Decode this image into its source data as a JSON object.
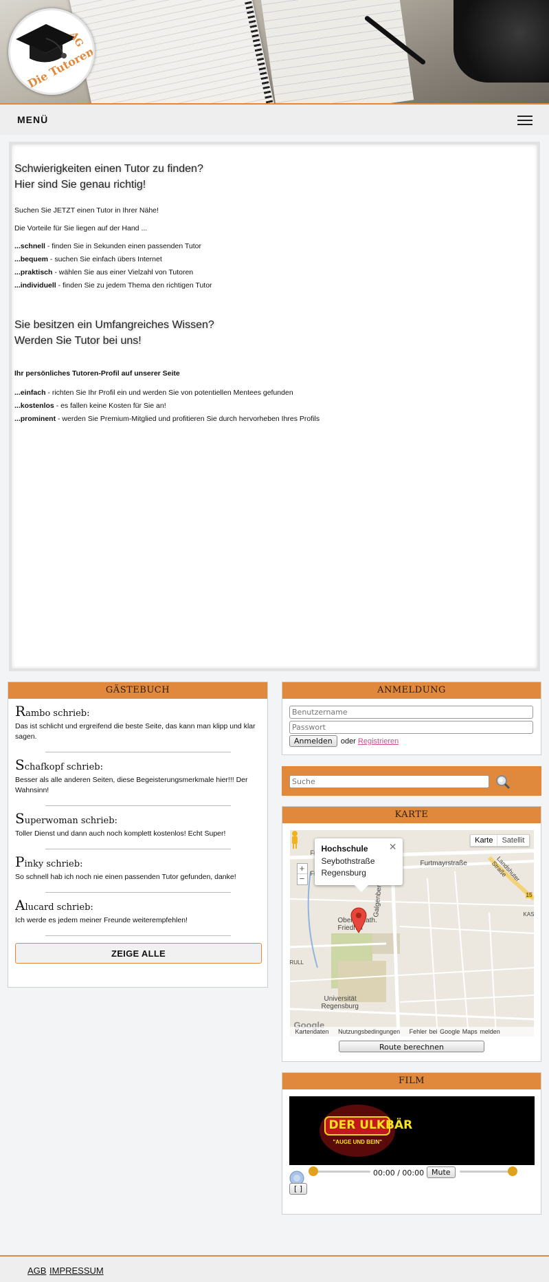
{
  "header": {
    "logo_text": "Die Tutoren AG"
  },
  "menu": {
    "label": "MENÜ",
    "toggle_icon": "hamburger-icon"
  },
  "main": {
    "heading1_line1": "Schwierigkeiten einen Tutor zu finden?",
    "heading1_line2": "Hier sind Sie genau richtig!",
    "intro1": "Suchen Sie JETZT einen Tutor in Ihrer Nähe!",
    "intro2": "Die Vorteile für Sie liegen auf der Hand ...",
    "advantages": [
      {
        "key": "...schnell",
        "text": " - finden Sie in Sekunden einen passenden Tutor"
      },
      {
        "key": "...bequem",
        "text": " - suchen Sie einfach übers Internet"
      },
      {
        "key": "...praktisch",
        "text": " - wählen Sie aus einer Vielzahl von Tutoren"
      },
      {
        "key": "...individuell",
        "text": " - finden Sie zu jedem Thema den richtigen Tutor"
      }
    ],
    "heading2_line1": "Sie besitzen ein Umfangreiches Wissen?",
    "heading2_line2": "Werden Sie Tutor bei uns!",
    "profile_title": "Ihr persönliches Tutoren-Profil auf unserer Seite",
    "profile_features": [
      {
        "key": "...einfach",
        "text": " - richten Sie Ihr Profil ein und werden Sie von potentiellen Mentees gefunden"
      },
      {
        "key": "...kostenlos",
        "text": " - es fallen keine Kosten für Sie an!"
      },
      {
        "key": "...prominent",
        "text": " - werden Sie Premium-Mitglied und profitieren Sie durch hervorheben Ihres Profils"
      }
    ]
  },
  "guestbook": {
    "title": "GÄSTEBUCH",
    "entries": [
      {
        "cap": "R",
        "name": "ambo schrieb:",
        "text": "Das ist schlicht und ergreifend die beste Seite, das kann man klipp und klar sagen."
      },
      {
        "cap": "S",
        "name": "chafkopf schrieb:",
        "text": "Besser als alle anderen Seiten, diese Begeisterungsmerkmale hier!!! Der Wahnsinn!"
      },
      {
        "cap": "S",
        "name": "uperwoman schrieb:",
        "text": "Toller Dienst und dann auch noch komplett kostenlos! Echt Super!"
      },
      {
        "cap": "P",
        "name": "inky schrieb:",
        "text": "So schnell hab ich noch nie einen passenden Tutor gefunden, danke!"
      },
      {
        "cap": "A",
        "name": "lucard schrieb:",
        "text": "Ich werde es jedem meiner Freunde weiterempfehlen!"
      }
    ],
    "show_all": "ZEIGE ALLE"
  },
  "login": {
    "title": "ANMELDUNG",
    "username_placeholder": "Benutzername",
    "password_placeholder": "Passwort",
    "login_button": "Anmelden",
    "or_text": "oder",
    "register_link": "Registrieren"
  },
  "search": {
    "placeholder": "Suche",
    "icon": "magnifier-icon"
  },
  "map": {
    "title": "KARTE",
    "popup_title": "Hochschule",
    "popup_street": "Seybothstraße",
    "popup_city": "Regensburg",
    "popup_close": "✕",
    "type_map": "Karte",
    "type_satellite": "Satellit",
    "zoom_in": "+",
    "zoom_out": "−",
    "labels": {
      "furtmayr": "Furtmayrstraße",
      "landshuter": "Landshuter Straße",
      "galgenberg": "Galgenbergstraße",
      "friedhof": "Oberer Kath. Friedhof",
      "uni1": "Universität",
      "uni2": "Regensburg",
      "kas": "KAS",
      "rull": "RULL",
      "fr1": "Fr",
      "fr2": "Fr",
      "road15": "15",
      "google": "Google"
    },
    "footer": {
      "data": "Kartendaten",
      "terms": "Nutzungsbedingungen",
      "report": "Fehler bei Google Maps melden"
    },
    "route_button": "Route berechnen"
  },
  "film": {
    "title": "FILM",
    "poster_title": "DER ULKBÄR",
    "poster_subtitle": "\"AUGE UND BEIN\"",
    "time": "00:00 / 00:00",
    "mute": "Mute",
    "fullscreen": "[ ]",
    "progress_fraction": 0.0,
    "volume_fraction": 1.0
  },
  "footer": {
    "agb": "AGB",
    "impressum": "IMPRESSUM"
  },
  "colors": {
    "accent": "#e0893c",
    "link_pink": "#d04d8a"
  }
}
